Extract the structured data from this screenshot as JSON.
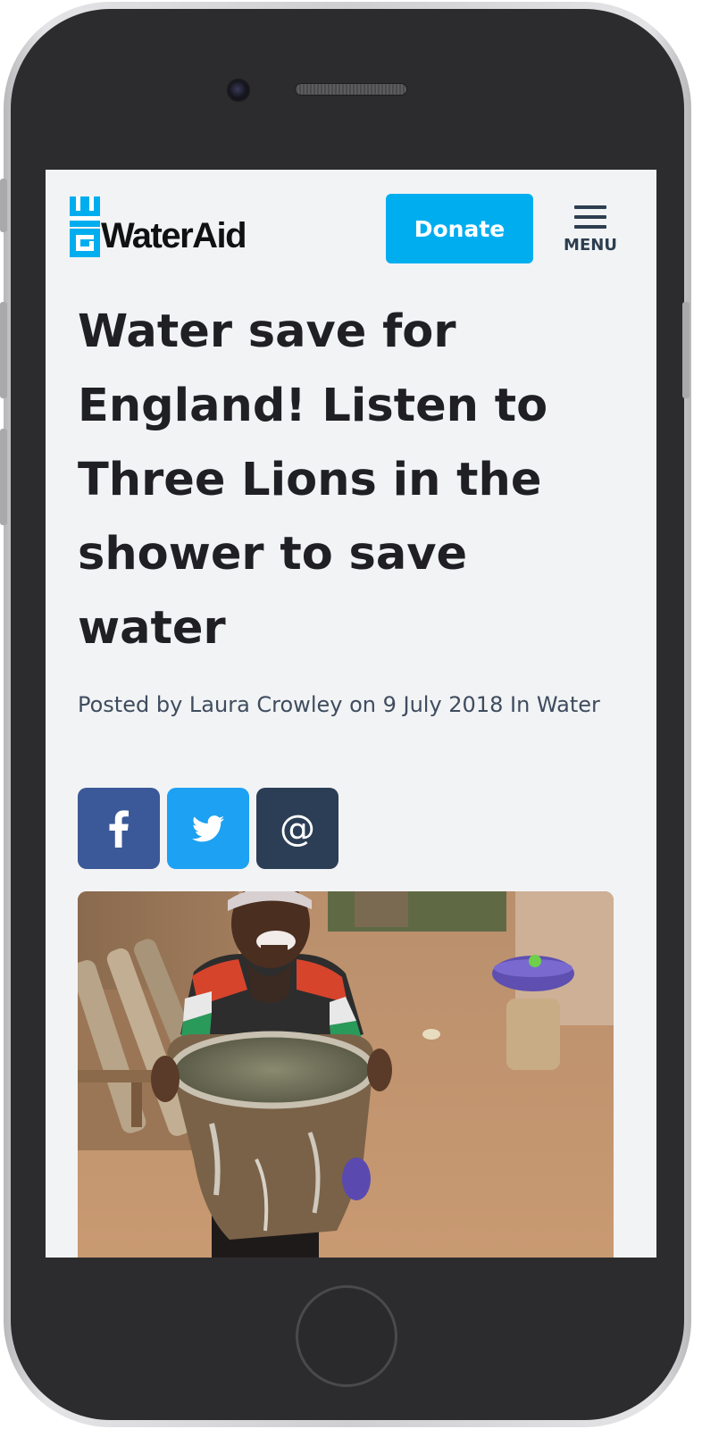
{
  "brand": {
    "name": "WaterAid",
    "primary_color": "#00aeef",
    "text_color": "#1f1f24"
  },
  "header": {
    "donate_label": "Donate",
    "menu_label": "MENU"
  },
  "article": {
    "title": "Water save for England! Listen to Three Lions in the shower to save water",
    "meta": "Posted by Laura Crowley on 9 July 2018 In Water"
  },
  "share": {
    "items": [
      {
        "network": "facebook",
        "icon": "facebook-icon",
        "color": "#3b5998"
      },
      {
        "network": "twitter",
        "icon": "twitter-icon",
        "color": "#1da1f2"
      },
      {
        "network": "email",
        "icon": "at-sign-icon",
        "color": "#2c3e55",
        "glyph": "@"
      }
    ]
  },
  "hero_image": {
    "subject": "woman-holding-bucket-of-water"
  }
}
